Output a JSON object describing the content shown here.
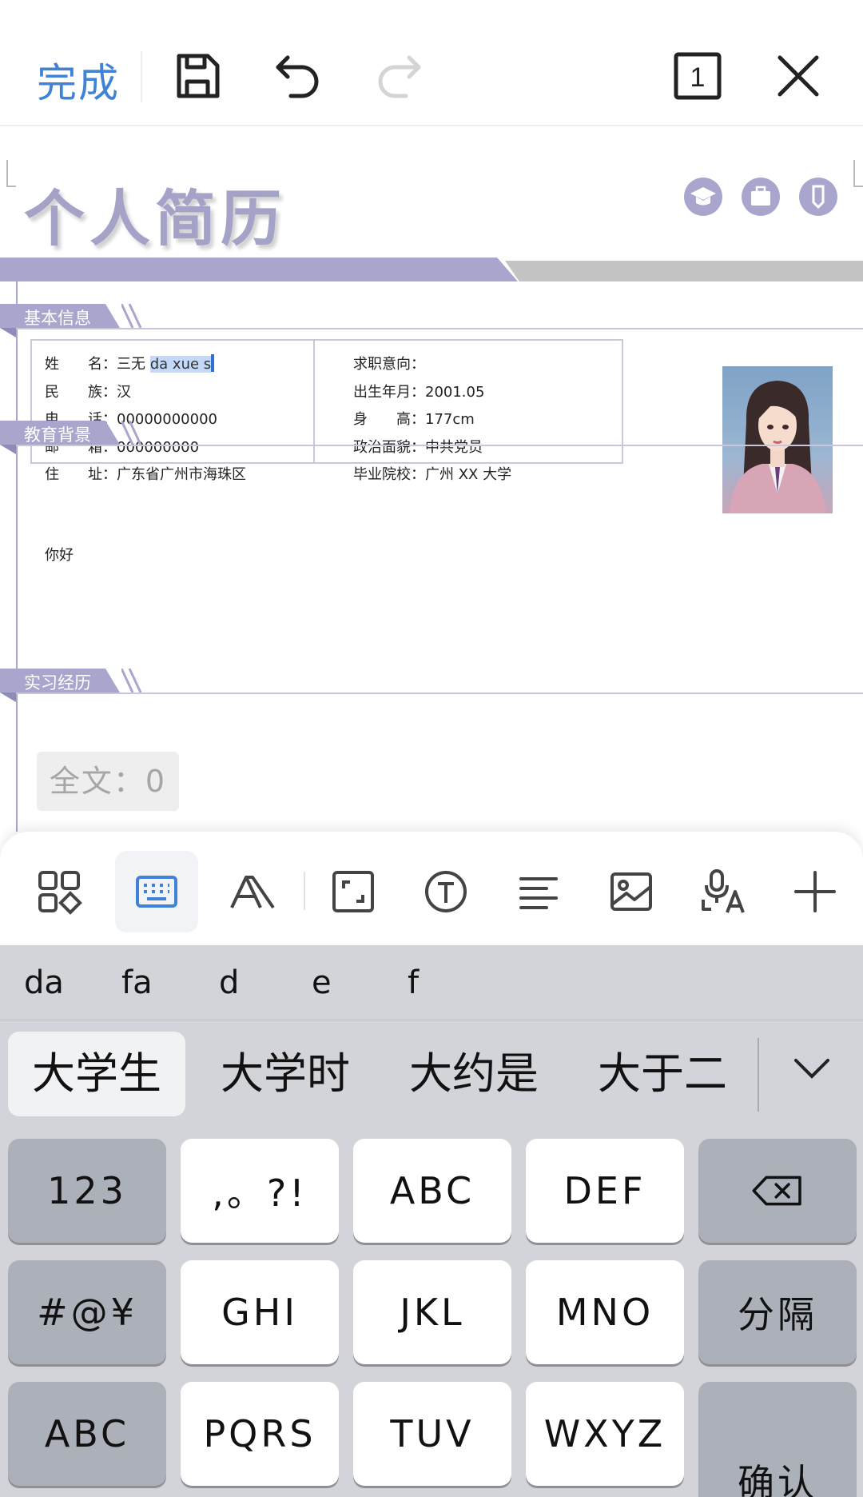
{
  "toolbar": {
    "done_label": "完成",
    "page_count": "1"
  },
  "document": {
    "title": "个人简历",
    "sections": {
      "basic": "基本信息",
      "education": "教育背景",
      "internship": "实习经历"
    },
    "basic_info": {
      "left": [
        {
          "label": "姓　　名：",
          "value": "三无 ",
          "selected": "da xue s"
        },
        {
          "label": "民　　族：",
          "value": "汉"
        },
        {
          "label": "电　　话：",
          "value": "00000000000"
        },
        {
          "label": "邮　　箱：",
          "value": "000000000"
        },
        {
          "label": "住　　址：",
          "value": "广东省广州市海珠区"
        }
      ],
      "right": [
        {
          "label": "求职意向：",
          "value": ""
        },
        {
          "label": "出生年月：",
          "value": "2001.05"
        },
        {
          "label": "身　　高：",
          "value": "177cm"
        },
        {
          "label": "政治面貌：",
          "value": "中共党员"
        },
        {
          "label": "毕业院校：",
          "value": "广州 XX 大学"
        }
      ]
    },
    "education_text": "你好",
    "word_count_label": "全文：0"
  },
  "format_bar": {
    "icons": [
      "grid-icon",
      "keyboard-icon",
      "font-style-icon",
      "fullscreen-icon",
      "text-icon",
      "align-icon",
      "image-icon",
      "voice-translate-icon",
      "add-icon"
    ]
  },
  "keyboard": {
    "pinyin": [
      "da",
      "fa",
      "d",
      "e",
      "f"
    ],
    "candidates": [
      "大学生",
      "大学时",
      "大约是",
      "大于二"
    ],
    "keys": {
      "num": "123",
      "punct": ",。?!",
      "abc": "ABC",
      "def": "DEF",
      "sym": "#@¥",
      "ghi": "GHI",
      "jkl": "JKL",
      "mno": "MNO",
      "separator": "分隔",
      "abc_switch": "ABC",
      "pqrs": "PQRS",
      "tuv": "TUV",
      "wxyz": "WXYZ",
      "confirm": "确认"
    }
  },
  "colors": {
    "accent": "#3f82d6",
    "resume_purple": "#a8a6cc",
    "keyboard_bg": "#d2d4d9"
  }
}
